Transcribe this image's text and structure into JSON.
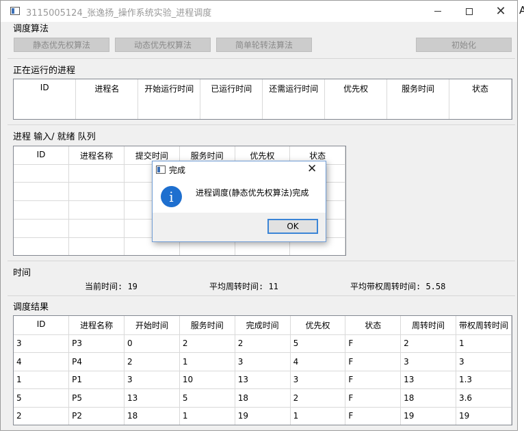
{
  "window": {
    "title": "3115005124_张逸扬_操作系统实验_进程调度",
    "edge_char": "A"
  },
  "schedule_algo": {
    "label": "调度算法",
    "buttons": [
      "静态优先权算法",
      "动态优先权算法",
      "简单轮转法算法"
    ],
    "init_button": "初始化"
  },
  "running": {
    "label": "正在运行的进程",
    "headers": [
      "ID",
      "进程名",
      "开始运行时间",
      "已运行时间",
      "还需运行时间",
      "优先权",
      "服务时间",
      "状态"
    ]
  },
  "queue": {
    "label": "进程 输入/ 就绪 队列",
    "headers": [
      "ID",
      "进程名称",
      "提交时间",
      "服务时间",
      "优先权",
      "状态"
    ]
  },
  "time": {
    "label": "时间",
    "current": "当前时间: 19",
    "avg_turnaround": "平均周转时间: 11",
    "avg_weighted": "平均带权周转时间: 5.58"
  },
  "result": {
    "label": "调度结果",
    "headers": [
      "ID",
      "进程名称",
      "开始时间",
      "服务时间",
      "完成时间",
      "优先权",
      "状态",
      "周转时间",
      "带权周转时间"
    ],
    "rows": [
      [
        "3",
        "P3",
        "0",
        "2",
        "2",
        "5",
        "F",
        "2",
        "1"
      ],
      [
        "4",
        "P4",
        "2",
        "1",
        "3",
        "4",
        "F",
        "3",
        "3"
      ],
      [
        "1",
        "P1",
        "3",
        "10",
        "13",
        "3",
        "F",
        "13",
        "1.3"
      ],
      [
        "5",
        "P5",
        "13",
        "5",
        "18",
        "2",
        "F",
        "18",
        "3.6"
      ],
      [
        "2",
        "P2",
        "18",
        "1",
        "19",
        "1",
        "F",
        "19",
        "19"
      ]
    ]
  },
  "dialog": {
    "title": "完成",
    "message": "进程调度(静态优先权算法)完成",
    "ok": "OK"
  }
}
